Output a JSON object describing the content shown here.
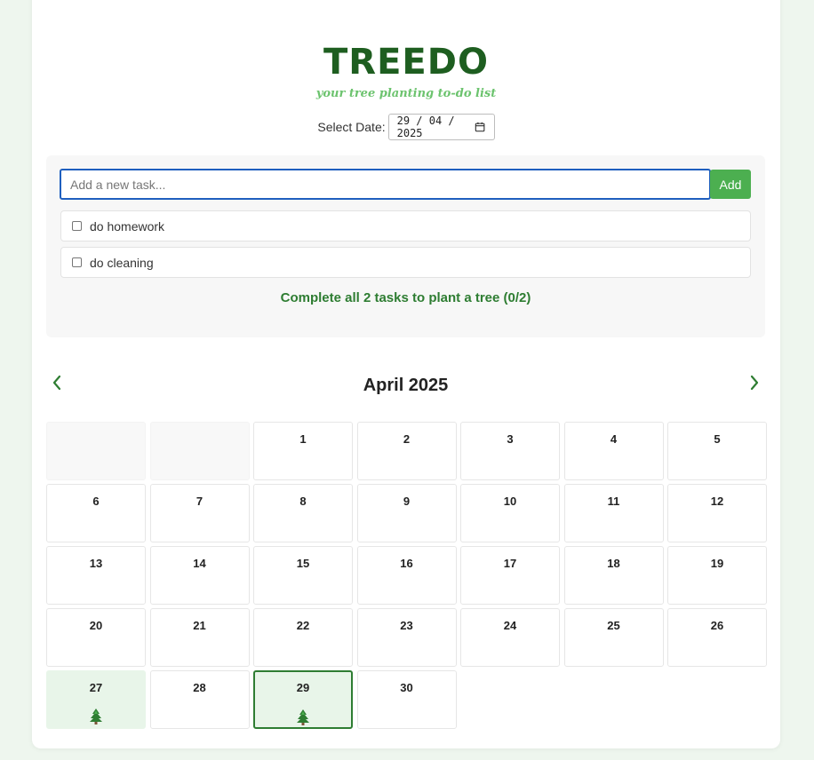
{
  "app": {
    "title": "TREEDO",
    "subtitle": "your tree planting to-do list"
  },
  "date_picker": {
    "label": "Select Date:",
    "value": "29 / 04 / 2025"
  },
  "tasks": {
    "input_placeholder": "Add a new task...",
    "add_label": "Add",
    "items": [
      {
        "label": "do homework",
        "done": false
      },
      {
        "label": "do cleaning",
        "done": false
      }
    ],
    "progress_text": "Complete all 2 tasks to plant a tree (0/2)"
  },
  "calendar": {
    "month_label": "April 2025",
    "prev_icon": "chevron-left-icon",
    "next_icon": "chevron-right-icon",
    "leading_empty": 2,
    "days": [
      "1",
      "2",
      "3",
      "4",
      "5",
      "6",
      "7",
      "8",
      "9",
      "10",
      "11",
      "12",
      "13",
      "14",
      "15",
      "16",
      "17",
      "18",
      "19",
      "20",
      "21",
      "22",
      "23",
      "24",
      "25",
      "26",
      "27",
      "28",
      "29",
      "30"
    ],
    "planted_days": [
      "27",
      "29"
    ],
    "selected_day": "29",
    "tree_icon": "tree-icon"
  },
  "colors": {
    "brand_dark": "#1e5e20",
    "brand_light": "#6cc36e",
    "add_button": "#4caf50",
    "progress_text": "#2e7d32",
    "planted_bg": "#e8f5e9",
    "background": "#eef6ee"
  }
}
